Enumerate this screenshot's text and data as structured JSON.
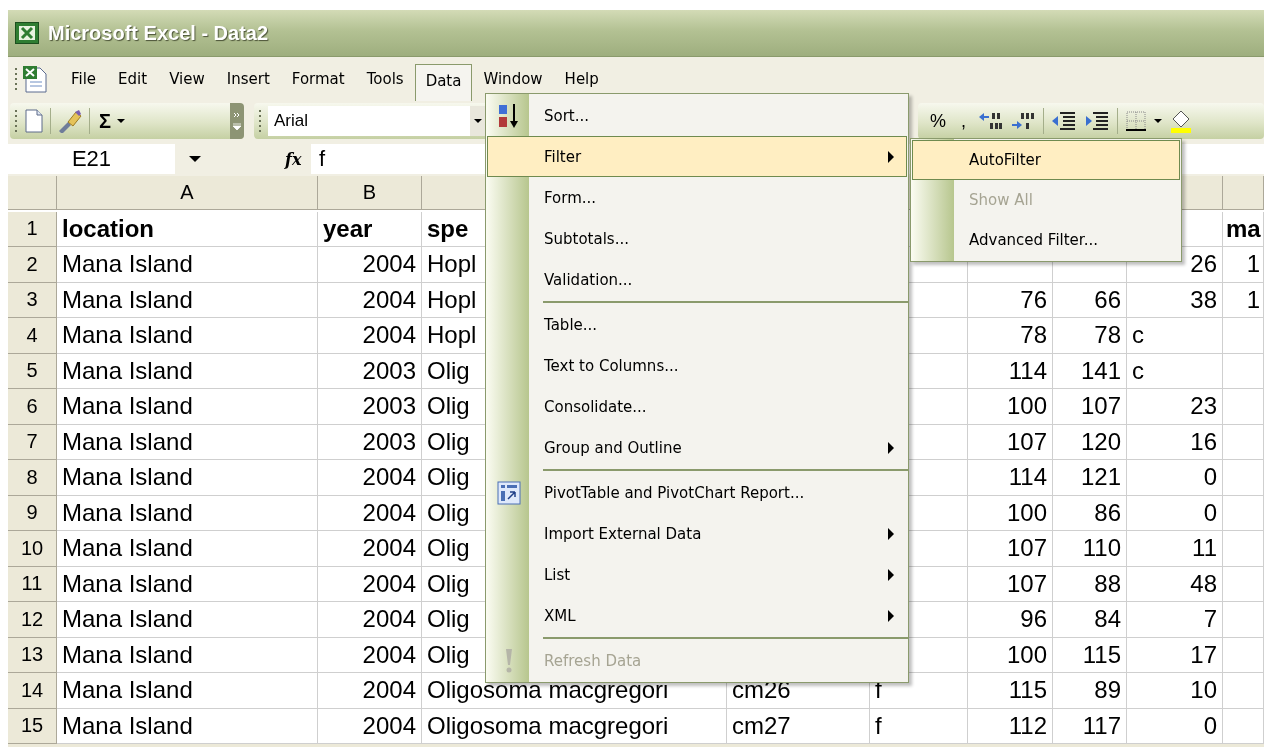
{
  "window": {
    "title": "Microsoft Excel - Data2"
  },
  "menu_bar": [
    {
      "label": "File",
      "selected": false
    },
    {
      "label": "Edit",
      "selected": false
    },
    {
      "label": "View",
      "selected": false
    },
    {
      "label": "Insert",
      "selected": false
    },
    {
      "label": "Format",
      "selected": false
    },
    {
      "label": "Tools",
      "selected": false
    },
    {
      "label": "Data",
      "selected": true
    },
    {
      "label": "Window",
      "selected": false
    },
    {
      "label": "Help",
      "selected": false
    }
  ],
  "toolbar": {
    "sum": "Σ",
    "font": "Arial",
    "percent": "%",
    "comma": ","
  },
  "formula_bar": {
    "name_box": "E21",
    "fx": "fx",
    "value": "f"
  },
  "column_headers": [
    "A",
    "B"
  ],
  "rows": [
    {
      "number": "1",
      "bold": true,
      "text": {
        "A": "location",
        "B": "year",
        "C": "spe",
        "I": "ma"
      },
      "numbers": {}
    },
    {
      "number": "2",
      "bold": false,
      "text": {
        "A": "Mana Island",
        "C": "Hopl"
      },
      "numbers": {
        "B": "2004",
        "H": "26",
        "I": "1"
      }
    },
    {
      "number": "3",
      "bold": false,
      "text": {
        "A": "Mana Island",
        "C": "Hopl"
      },
      "numbers": {
        "B": "2004",
        "F": "76",
        "G": "66",
        "H": "38",
        "I": "1"
      }
    },
    {
      "number": "4",
      "bold": false,
      "text": {
        "A": "Mana Island",
        "C": "Hopl",
        "H": "c"
      },
      "numbers": {
        "B": "2004",
        "F": "78",
        "G": "78"
      }
    },
    {
      "number": "5",
      "bold": false,
      "text": {
        "A": "Mana Island",
        "C": "Olig",
        "H": "c"
      },
      "numbers": {
        "B": "2003",
        "F": "114",
        "G": "141"
      }
    },
    {
      "number": "6",
      "bold": false,
      "text": {
        "A": "Mana Island",
        "C": "Olig"
      },
      "numbers": {
        "B": "2003",
        "F": "100",
        "G": "107",
        "H": "23"
      }
    },
    {
      "number": "7",
      "bold": false,
      "text": {
        "A": "Mana Island",
        "C": "Olig"
      },
      "numbers": {
        "B": "2003",
        "F": "107",
        "G": "120",
        "H": "16"
      }
    },
    {
      "number": "8",
      "bold": false,
      "text": {
        "A": "Mana Island",
        "C": "Olig"
      },
      "numbers": {
        "B": "2004",
        "F": "114",
        "G": "121",
        "H": "0"
      }
    },
    {
      "number": "9",
      "bold": false,
      "text": {
        "A": "Mana Island",
        "C": "Olig"
      },
      "numbers": {
        "B": "2004",
        "F": "100",
        "G": "86",
        "H": "0"
      }
    },
    {
      "number": "10",
      "bold": false,
      "text": {
        "A": "Mana Island",
        "C": "Olig"
      },
      "numbers": {
        "B": "2004",
        "F": "107",
        "G": "110",
        "H": "11"
      }
    },
    {
      "number": "11",
      "bold": false,
      "text": {
        "A": "Mana Island",
        "C": "Olig"
      },
      "numbers": {
        "B": "2004",
        "F": "107",
        "G": "88",
        "H": "48"
      }
    },
    {
      "number": "12",
      "bold": false,
      "text": {
        "A": "Mana Island",
        "C": "Olig"
      },
      "numbers": {
        "B": "2004",
        "F": "96",
        "G": "84",
        "H": "7"
      }
    },
    {
      "number": "13",
      "bold": false,
      "text": {
        "A": "Mana Island",
        "C": "Olig"
      },
      "numbers": {
        "B": "2004",
        "F": "100",
        "G": "115",
        "H": "17"
      }
    },
    {
      "number": "14",
      "bold": false,
      "text": {
        "A": "Mana Island",
        "C": "Oligosoma macgregori",
        "D": "cm26",
        "E": "f"
      },
      "numbers": {
        "B": "2004",
        "F": "115",
        "G": "89",
        "H": "10"
      }
    },
    {
      "number": "15",
      "bold": false,
      "text": {
        "A": "Mana Island",
        "C": "Oligosoma macgregori",
        "D": "cm27",
        "E": "f"
      },
      "numbers": {
        "B": "2004",
        "F": "112",
        "G": "117",
        "H": "0"
      }
    }
  ],
  "data_menu": [
    {
      "kind": "item",
      "label": "Sort...",
      "selected": false,
      "disabled": false,
      "submenu": false
    },
    {
      "kind": "item",
      "label": "Filter",
      "selected": true,
      "disabled": false,
      "submenu": true
    },
    {
      "kind": "item",
      "label": "Form...",
      "selected": false,
      "disabled": false,
      "submenu": false
    },
    {
      "kind": "item",
      "label": "Subtotals...",
      "selected": false,
      "disabled": false,
      "submenu": false
    },
    {
      "kind": "item",
      "label": "Validation...",
      "selected": false,
      "disabled": false,
      "submenu": false
    },
    {
      "kind": "separator"
    },
    {
      "kind": "item",
      "label": "Table...",
      "selected": false,
      "disabled": false,
      "submenu": false
    },
    {
      "kind": "item",
      "label": "Text to Columns...",
      "selected": false,
      "disabled": false,
      "submenu": false
    },
    {
      "kind": "item",
      "label": "Consolidate...",
      "selected": false,
      "disabled": false,
      "submenu": false
    },
    {
      "kind": "item",
      "label": "Group and Outline",
      "selected": false,
      "disabled": false,
      "submenu": true
    },
    {
      "kind": "separator"
    },
    {
      "kind": "item",
      "label": "PivotTable and PivotChart Report...",
      "selected": false,
      "disabled": false,
      "submenu": false
    },
    {
      "kind": "item",
      "label": "Import External Data",
      "selected": false,
      "disabled": false,
      "submenu": true
    },
    {
      "kind": "item",
      "label": "List",
      "selected": false,
      "disabled": false,
      "submenu": true
    },
    {
      "kind": "item",
      "label": "XML",
      "selected": false,
      "disabled": false,
      "submenu": true
    },
    {
      "kind": "separator"
    },
    {
      "kind": "item",
      "label": "Refresh Data",
      "selected": false,
      "disabled": true,
      "submenu": false
    }
  ],
  "filter_submenu": [
    {
      "label": "AutoFilter",
      "selected": true,
      "disabled": false
    },
    {
      "label": "Show All",
      "selected": false,
      "disabled": true
    },
    {
      "label": "Advanced Filter...",
      "selected": false,
      "disabled": false
    }
  ]
}
